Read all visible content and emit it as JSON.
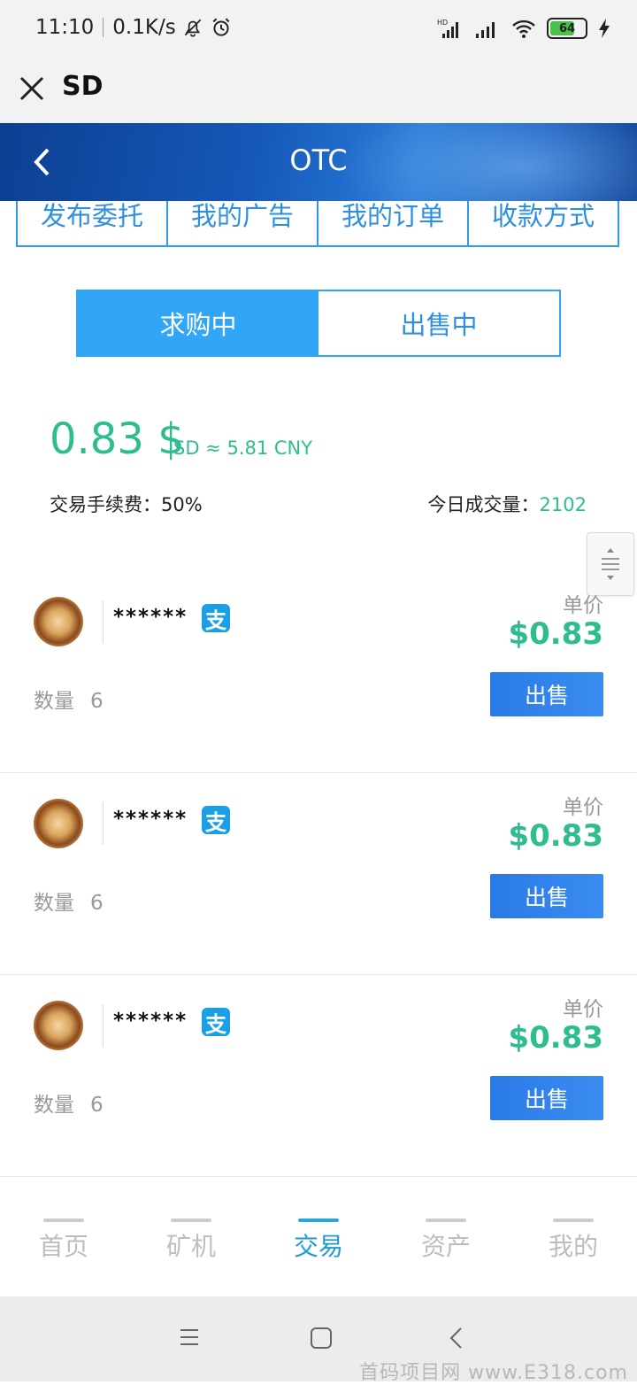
{
  "status_bar": {
    "time": "11:10",
    "speed": "0.1K/s",
    "battery": "64",
    "icons": [
      "bell-off-icon",
      "alarm-icon",
      "hd-signal-icon",
      "signal-icon",
      "wifi-icon",
      "battery-icon",
      "charging-icon"
    ]
  },
  "webview": {
    "title": "SD",
    "close_icon": "close-icon"
  },
  "header": {
    "title": "OTC",
    "back_icon": "chevron-left-icon"
  },
  "top_nav": [
    "发布委托",
    "我的广告",
    "我的订单",
    "收款方式"
  ],
  "segment": {
    "buy": "求购中",
    "sell": "出售中",
    "active": "buy"
  },
  "price": {
    "value": "0.83 $",
    "sub": "SD ≈ 5.81 CNY",
    "fee_label": "交易手续费：",
    "fee_value": "50%",
    "volume_label": "今日成交量：",
    "volume_value": "2102"
  },
  "orders": [
    {
      "user": "******",
      "unit_label": "单价",
      "price": "$0.83",
      "qty_label": "数量",
      "qty": "6",
      "action": "出售"
    },
    {
      "user": "******",
      "unit_label": "单价",
      "price": "$0.83",
      "qty_label": "数量",
      "qty": "6",
      "action": "出售"
    },
    {
      "user": "******",
      "unit_label": "单价",
      "price": "$0.83",
      "qty_label": "数量",
      "qty": "6",
      "action": "出售"
    }
  ],
  "tabbar": [
    {
      "label": "首页",
      "active": false
    },
    {
      "label": "矿机",
      "active": false
    },
    {
      "label": "交易",
      "active": true
    },
    {
      "label": "资产",
      "active": false
    },
    {
      "label": "我的",
      "active": false
    }
  ],
  "watermark": "首码项目网 www.E318.com",
  "colors": {
    "accent_green": "#2ebd8f",
    "primary_blue": "#31a5f6",
    "button_blue": "#2a7ae6"
  }
}
